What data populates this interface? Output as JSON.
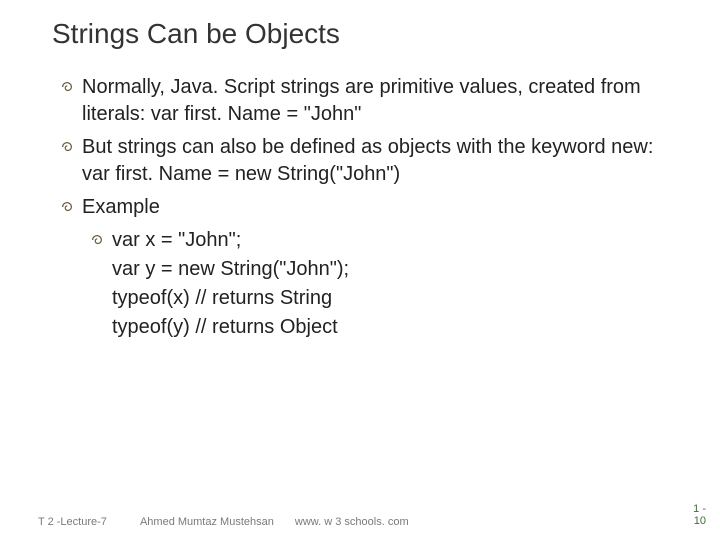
{
  "title": "Strings Can be Objects",
  "bullets": {
    "p1": "Normally, Java. Script strings are primitive values, created from literals: var first. Name = \"John\"",
    "p2": "But strings can also be defined as objects with the keyword new: var first. Name = new String(\"John\")",
    "p3": "Example",
    "c1": "var x = \"John\";",
    "c2": "var y = new String(\"John\");",
    "c3": "typeof(x) // returns String",
    "c4": "typeof(y) // returns Object"
  },
  "footer": {
    "left": "T 2 -Lecture-7",
    "author": "Ahmed Mumtaz Mustehsan",
    "url": "www. w 3 schools. com",
    "page_a": "1 -",
    "page_b": "10"
  }
}
